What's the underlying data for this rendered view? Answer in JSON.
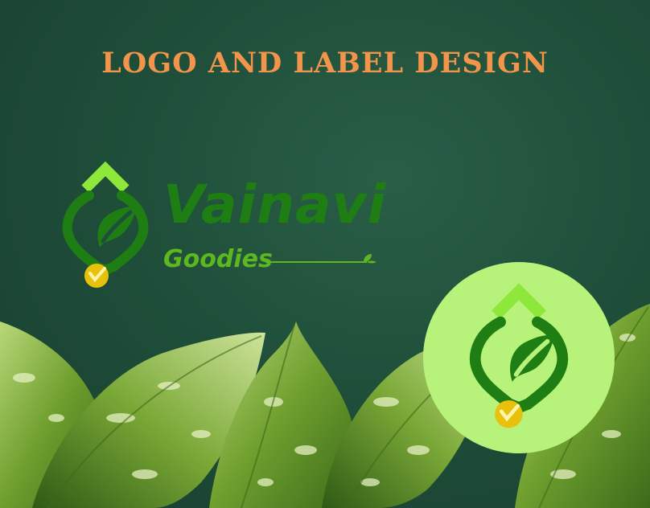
{
  "headline": "LOGO AND LABEL DESIGN",
  "brand": {
    "name": "Vainavi",
    "tagline": "Goodies"
  },
  "colors": {
    "background": "#1f4f3a",
    "headline": "#f2954a",
    "brand_dark_green": "#1e7e14",
    "brand_light_green": "#5db81f",
    "chevron_lime": "#8ee83c",
    "seed_gold": "#e8c10c",
    "badge_bg": "#b7f27a"
  },
  "icons": {
    "logo_mark": "leaf-seed-logo-icon",
    "sprout": "sprout-icon",
    "foliage": "variegated-leaves"
  }
}
